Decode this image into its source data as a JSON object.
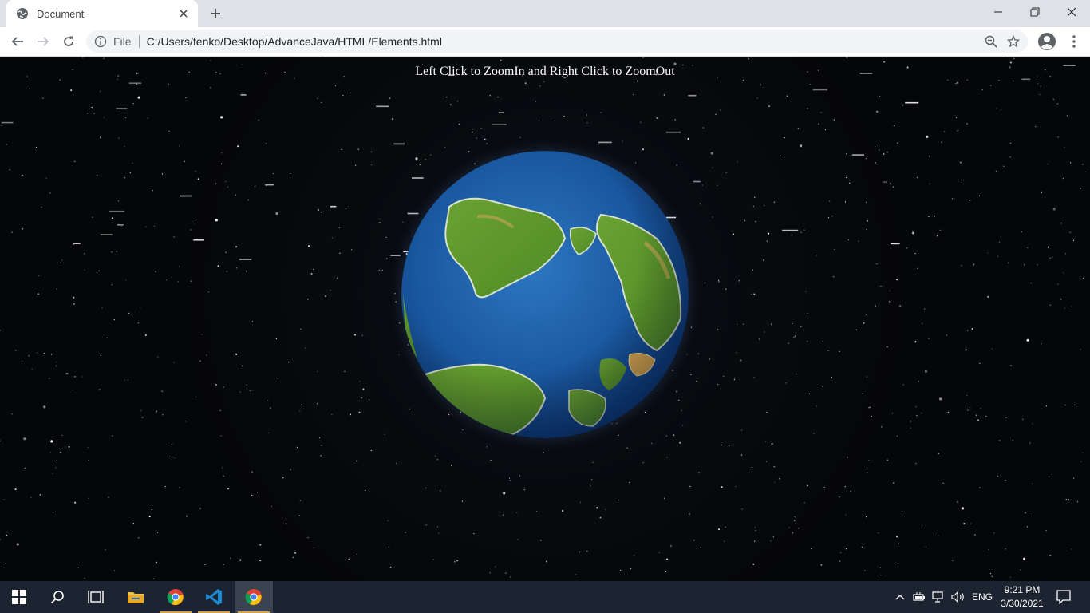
{
  "browser": {
    "tab": {
      "title": "Document",
      "favicon": "globe-icon"
    },
    "address": {
      "scheme_label": "File",
      "url": "C:/Users/fenko/Desktop/AdvanceJava/HTML/Elements.html"
    },
    "icons": {
      "back": "back-arrow-icon",
      "forward": "forward-arrow-icon",
      "reload": "reload-icon",
      "zoom": "zoom-out-icon",
      "bookmark": "star-icon",
      "profile": "account-icon",
      "menu": "kebab-menu-icon"
    }
  },
  "page": {
    "hint": "Left Click to ZoomIn and Right Click to ZoomOut",
    "background": "starfield",
    "globe": "earth-globe"
  },
  "taskbar": {
    "items": [
      "windows-start-icon",
      "search-icon",
      "task-view-icon",
      "file-explorer-icon",
      "chrome-icon",
      "vscode-icon",
      "chrome-icon"
    ],
    "active_item": "chrome",
    "language": "ENG",
    "time": "9:21 PM",
    "date": "3/30/2021"
  },
  "colors": {
    "tab_strip": "#dee1e6",
    "page_background": "#050608",
    "taskbar": "#1b2430",
    "ocean": "#1f5fa8",
    "land": "#5f9a2e"
  }
}
